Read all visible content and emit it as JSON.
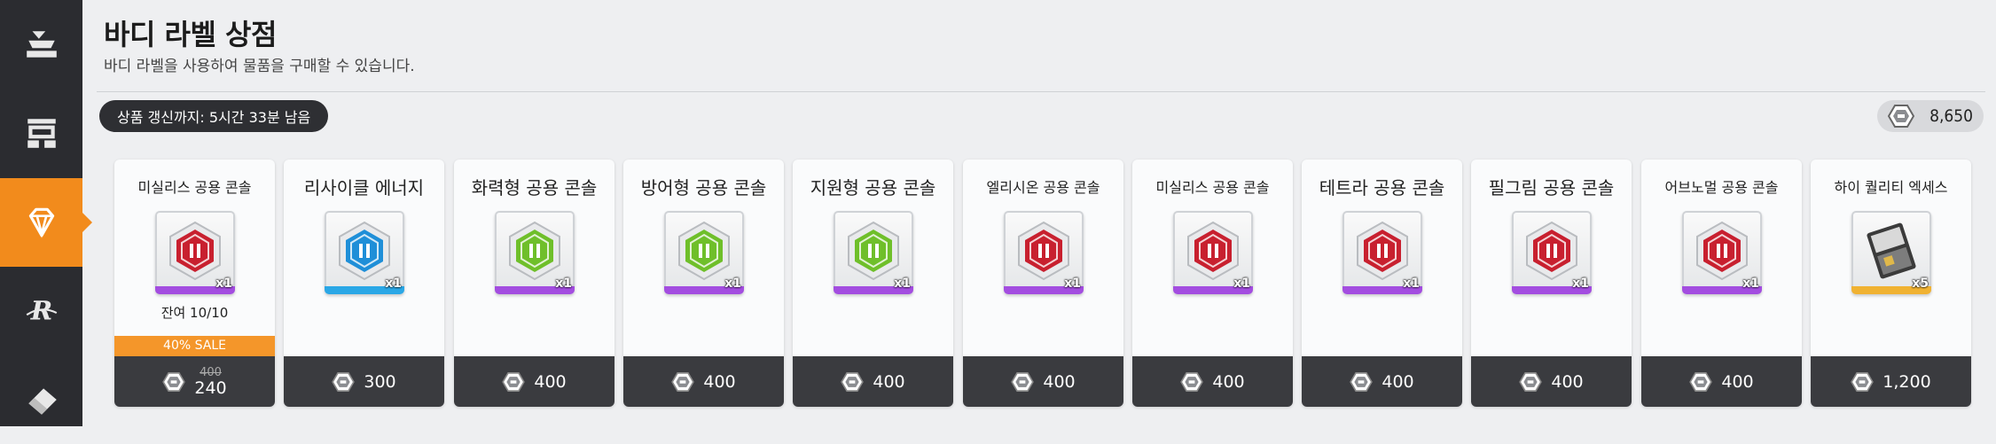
{
  "page": {
    "title": "바디 라벨 상점",
    "subtitle": "바디 라벨을 사용하여 물품을 구매할 수 있습니다."
  },
  "sidebar": {
    "items": [
      {
        "icon": "laboratory-icon",
        "active": false
      },
      {
        "icon": "shop-building-icon",
        "active": false
      },
      {
        "icon": "diamond-icon",
        "active": true
      },
      {
        "icon": "r-emblem-icon",
        "active": false
      },
      {
        "icon": "eraser-icon",
        "active": false
      }
    ]
  },
  "timer": {
    "text": "상품 갱신까지: 5시간 33분 남음"
  },
  "currency": {
    "icon": "body-label-icon",
    "amount": "8,650"
  },
  "colors": {
    "accent": "#f28b1c",
    "sidebar": "#2b2c30",
    "price_bar": "#3a3b3f",
    "sale": "#f4962a",
    "stripe_purple": "#a34de0",
    "stripe_blue": "#2aa7e6",
    "stripe_gold": "#f0b232"
  },
  "cards": [
    {
      "name": "미실리스 공용 콘솔",
      "emblem": "missilis-emblem-icon",
      "emblem_color": "#c8202f",
      "stripe": "purple",
      "qty": "x1",
      "remaining": "잔여 10/10",
      "sale": "40% SALE",
      "old_price": "400",
      "price": "240"
    },
    {
      "name": "리사이클 에너지",
      "emblem": "recycle-emblem-icon",
      "emblem_color": "#1f8fd8",
      "stripe": "blue",
      "qty": "x1",
      "price": "300",
      "large": true
    },
    {
      "name": "화력형 공용 콘솔",
      "emblem": "firepower-emblem-icon",
      "emblem_color": "#6fbf2a",
      "stripe": "purple",
      "qty": "x1",
      "price": "400",
      "large": true
    },
    {
      "name": "방어형 공용 콘솔",
      "emblem": "defense-emblem-icon",
      "emblem_color": "#6fbf2a",
      "stripe": "purple",
      "qty": "x1",
      "price": "400",
      "large": true
    },
    {
      "name": "지원형 공용 콘솔",
      "emblem": "support-emblem-icon",
      "emblem_color": "#6fbf2a",
      "stripe": "purple",
      "qty": "x1",
      "price": "400",
      "large": true
    },
    {
      "name": "엘리시온 공용 콘솔",
      "emblem": "elysion-emblem-icon",
      "emblem_color": "#c8202f",
      "stripe": "purple",
      "qty": "x1",
      "price": "400"
    },
    {
      "name": "미실리스 공용 콘솔",
      "emblem": "missilis-emblem-icon",
      "emblem_color": "#c8202f",
      "stripe": "purple",
      "qty": "x1",
      "price": "400"
    },
    {
      "name": "테트라 공용 콘솔",
      "emblem": "tetra-emblem-icon",
      "emblem_color": "#c8202f",
      "stripe": "purple",
      "qty": "x1",
      "price": "400",
      "large": true
    },
    {
      "name": "필그림 공용 콘솔",
      "emblem": "pilgrim-emblem-icon",
      "emblem_color": "#c8202f",
      "stripe": "purple",
      "qty": "x1",
      "price": "400",
      "large": true
    },
    {
      "name": "어브노멀 공용 콘솔",
      "emblem": "abnormal-emblem-icon",
      "emblem_color": "#c8202f",
      "stripe": "purple",
      "qty": "x1",
      "price": "400"
    },
    {
      "name": "하이 퀄리티 엑세스",
      "emblem": "access-card-icon",
      "emblem_color": "#555555",
      "stripe": "gold",
      "qty": "x5",
      "price": "1,200"
    }
  ]
}
